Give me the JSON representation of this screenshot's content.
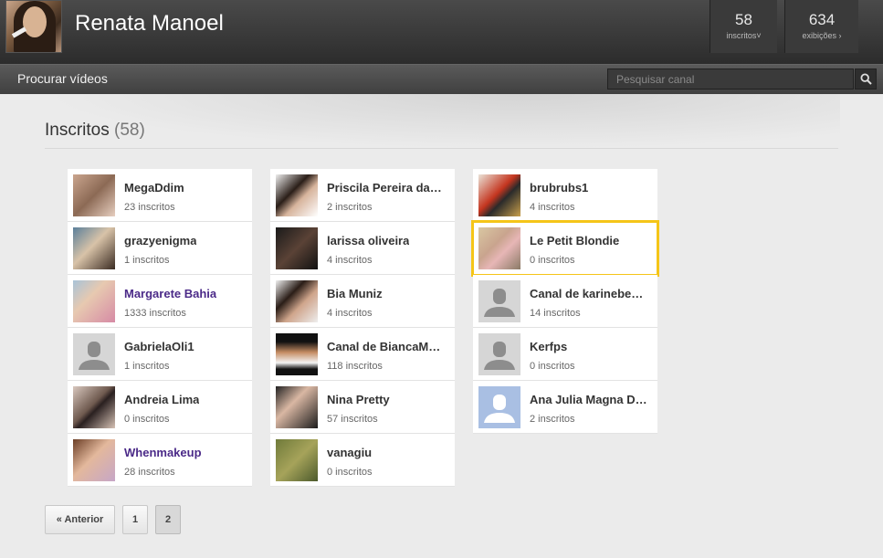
{
  "header": {
    "channel_name": "Renata Manoel",
    "subscribers": {
      "value": "58",
      "label": "inscritos"
    },
    "views": {
      "value": "634",
      "label": "exibições"
    }
  },
  "nav": {
    "browse_label": "Procurar vídeos",
    "search_placeholder": "Pesquisar canal"
  },
  "section": {
    "title": "Inscritos",
    "count": "(58)"
  },
  "columns": [
    [
      {
        "name": "MegaDdim",
        "subs": "23 inscritos",
        "thumb": "photo-makeup-eye",
        "linked": false
      },
      {
        "name": "grazyenigma",
        "subs": "1 inscritos",
        "thumb": "photo-couple",
        "linked": false
      },
      {
        "name": "Margarete Bahia",
        "subs": "1333 inscritos",
        "thumb": "photo-family",
        "linked": true
      },
      {
        "name": "GabrielaOli1",
        "subs": "1 inscritos",
        "thumb": "default-avatar",
        "linked": false
      },
      {
        "name": "Andreia Lima",
        "subs": "0 inscritos",
        "thumb": "photo-eye",
        "linked": false
      },
      {
        "name": "Whenmakeup",
        "subs": "28 inscritos",
        "thumb": "photo-woman-smile",
        "linked": true
      }
    ],
    [
      {
        "name": "Priscila Pereira da…",
        "subs": "2 inscritos",
        "thumb": "photo-woman-dark-hair",
        "linked": false
      },
      {
        "name": "larissa oliveira",
        "subs": "4 inscritos",
        "thumb": "photo-woman-dark",
        "linked": false
      },
      {
        "name": "Bia Muniz",
        "subs": "4 inscritos",
        "thumb": "photo-woman-face",
        "linked": false
      },
      {
        "name": "Canal de BiancaM…",
        "subs": "118 inscritos",
        "thumb": "photo-video-still",
        "linked": false
      },
      {
        "name": "Nina Pretty",
        "subs": "57 inscritos",
        "thumb": "photo-woman-pose",
        "linked": false
      },
      {
        "name": "vanagiu",
        "subs": "0 inscritos",
        "thumb": "photo-green-blur",
        "linked": false
      }
    ],
    [
      {
        "name": "brubrubs1",
        "subs": "4 inscritos",
        "thumb": "photo-objects",
        "linked": false
      },
      {
        "name": "Le Petit Blondie",
        "subs": "0 inscritos",
        "thumb": "photo-blonde",
        "linked": false,
        "highlighted": true
      },
      {
        "name": "Canal de karinebe…",
        "subs": "14 inscritos",
        "thumb": "default-avatar",
        "linked": false
      },
      {
        "name": "Kerfps",
        "subs": "0 inscritos",
        "thumb": "default-avatar",
        "linked": false
      },
      {
        "name": "Ana Julia Magna D…",
        "subs": "2 inscritos",
        "thumb": "default-avatar-blue",
        "linked": false
      }
    ]
  ],
  "pagination": {
    "prev_label": "« Anterior",
    "pages": [
      "1",
      "2"
    ],
    "current": "2"
  },
  "colors": {
    "highlight": "#f5c518",
    "link_name": "#4b2a88"
  }
}
